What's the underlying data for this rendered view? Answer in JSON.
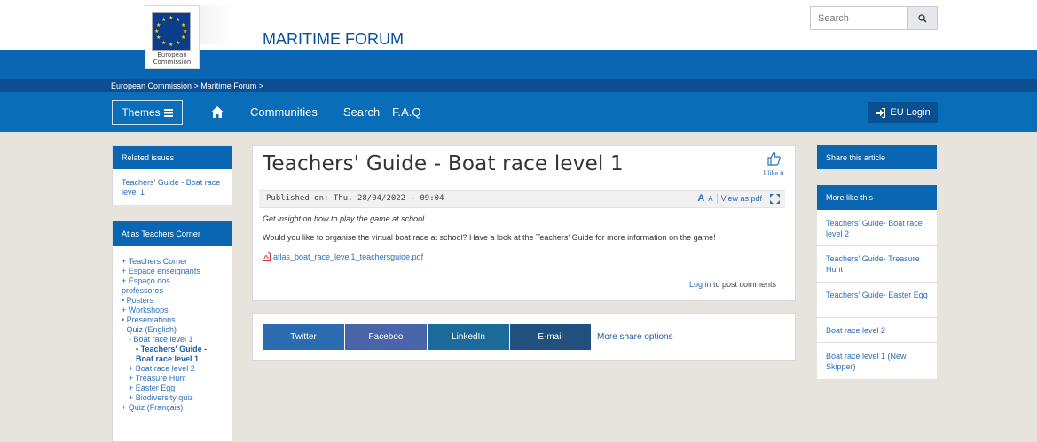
{
  "brand": {
    "logo_text": "European Commission",
    "site_title": "MARITIME FORUM"
  },
  "search": {
    "placeholder": "Search",
    "icon": "search-icon"
  },
  "breadcrumb": "European Commission > Maritime Forum >",
  "nav": {
    "themes_label": "Themes",
    "themes_icon": "hamburger-menu-icon",
    "home_icon": "home-icon",
    "links": [
      "Communities",
      "Search",
      "F.A.Q"
    ],
    "login_label": "EU Login",
    "login_icon": "login-arrow-icon"
  },
  "left_sidebar": {
    "related_title": "Related issues",
    "related_link": "Teachers' Guide - Boat race level 1",
    "atlas_title": "Atlas Teachers Corner",
    "tree": [
      "+ Teachers Corner",
      "+ Espace enseignants",
      "+ Espaço dos",
      "professores",
      "• Posters",
      "+ Workshops",
      "• Presentations",
      "- Quiz (English)",
      "- Boat race level 1",
      "• Teachers' Guide -",
      "Boat race level 1",
      "+ Boat race level 2",
      "+ Treasure Hunt",
      "+ Easter Egg",
      "+ Biodiversity quiz",
      "+ Quiz (Français)"
    ]
  },
  "article": {
    "title": "Teachers' Guide - Boat race level 1",
    "like_label": "I like it",
    "published": "Published on: Thu, 28/04/2022 - 09:04",
    "font_size_large": "A",
    "font_size_small": "A",
    "view_pdf": "View as pdf",
    "fullscreen_icon": "expand-icon",
    "intro": "Get insight on how to play the game at school.",
    "body": "Would you like to organise the virtual boat race at school? Have a look at the Teachers' Guide for more information on the game!",
    "attachment": "atlas_boat_race_level1_teachersguide.pdf",
    "login_link": "Log in",
    "login_suffix": " to post comments"
  },
  "share": {
    "buttons": [
      "Twitter",
      "Faceboo",
      "LinkedIn",
      "E-mail"
    ],
    "more": "More share options",
    "colors": [
      "#2b6cb0",
      "#4a64a8",
      "#1c6a9a",
      "#21507f"
    ]
  },
  "right_sidebar": {
    "share_title": "Share this article",
    "more_title": "More like this",
    "items": [
      "Teachers' Guide- Boat race level 2",
      "Teachers' Guide- Treasure Hunt",
      "Teachers' Guide- Easter Egg",
      "Boat race level 2",
      "Boat race level 1 (New Skipper)"
    ]
  },
  "colors": {
    "header_blue": "#0a66b3",
    "breadcrumb_blue": "#0b4f92",
    "nav_blue": "#0a6db8",
    "link_blue": "#2a6fb8",
    "page_bg": "#e6e4dd"
  }
}
